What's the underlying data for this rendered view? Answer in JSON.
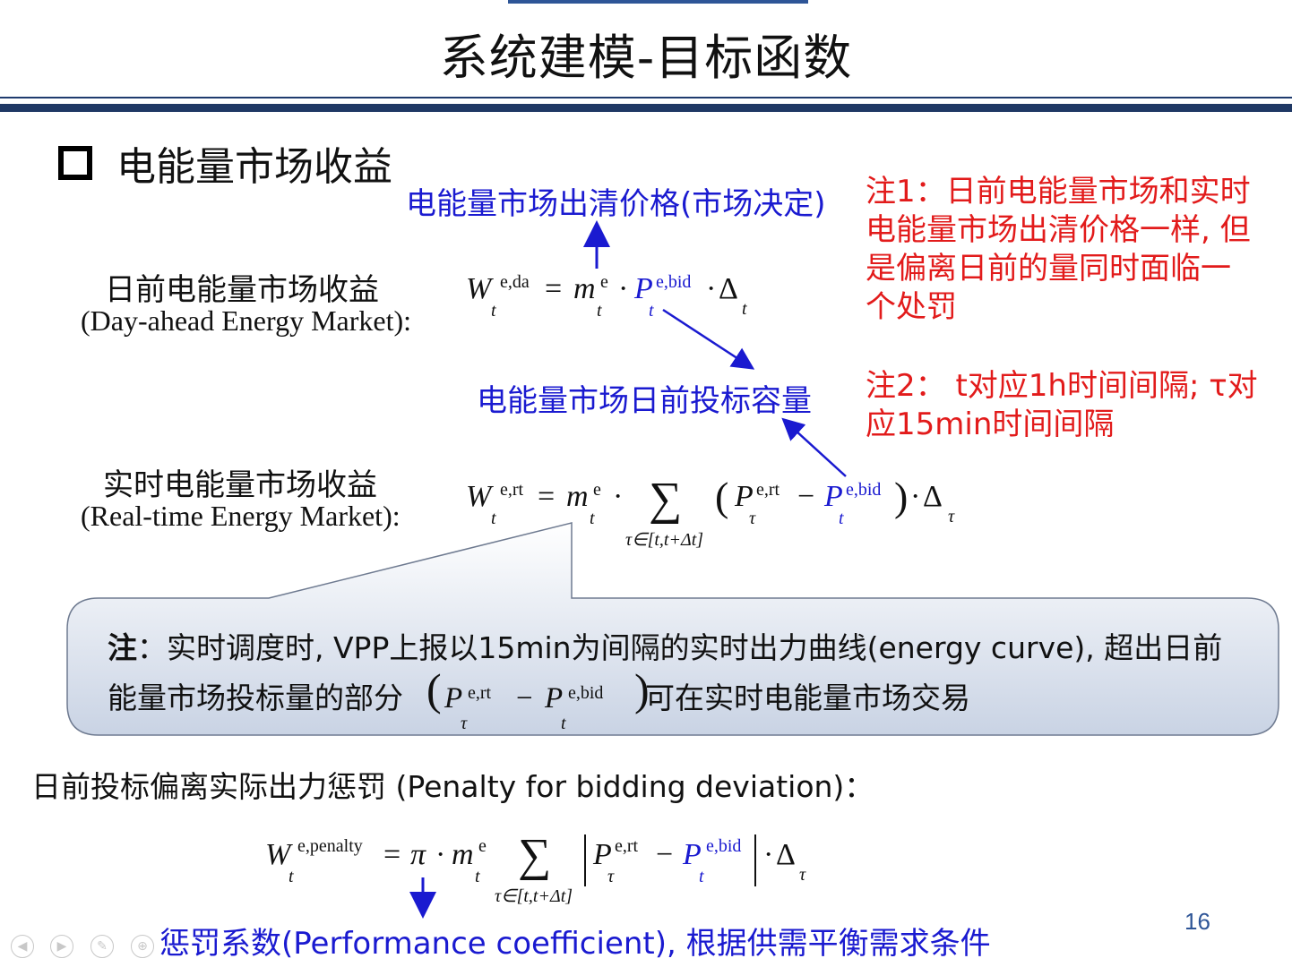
{
  "title": "系统建模-目标函数",
  "section_title": "电能量市场收益",
  "labels": {
    "clearing_price": "电能量市场出清价格(市场决定)",
    "bid_capacity": "电能量市场日前投标容量",
    "day_ahead_cn": "日前电能量市场收益",
    "day_ahead_en": "(Day-ahead Energy Market):",
    "real_time_cn": "实时电能量市场收益",
    "real_time_en": "(Real-time Energy Market):",
    "penalty_heading": "日前投标偏离实际出力惩罚 (Penalty for bidding deviation)：",
    "penalty_coeff": "惩罚系数(Performance coefficient), 根据供需平衡需求条件"
  },
  "notes": {
    "note1_lines": [
      "注1：日前电能量市场和实时",
      "电能量市场出清价格一样, 但",
      "是偏离日前的量同时面临一",
      "个处罚"
    ],
    "note2_lines": [
      "注2： t对应1h时间间隔; τ对",
      "应15min时间间隔"
    ]
  },
  "callout": {
    "prefix": "注",
    "line1": "：实时调度时, VPP上报以15min为间隔的实时出力曲线(energy curve), 超出日前",
    "line2_before": "能量市场投标量的部分",
    "line2_after": "可在实时电能量市场交易"
  },
  "equations": {
    "W": "W",
    "m": "m",
    "P": "P",
    "delta": "Δ",
    "sum": "∑",
    "pi": "π",
    "sup_da": "e,da",
    "sup_rt": "e,rt",
    "sup_pen": "e,penalty",
    "sup_e": "e",
    "sup_bid": "e,bid",
    "sub_t": "t",
    "sub_tau": "τ",
    "sum_range": "τ∈[t,t+Δt]"
  },
  "page_number": "16",
  "colors": {
    "accent_blue": "#1a1ad0",
    "note_red": "#e21b1b",
    "rule_navy": "#1f3864"
  },
  "nav_icons": [
    "back-icon",
    "forward-icon",
    "pen-icon",
    "zoom-icon"
  ]
}
